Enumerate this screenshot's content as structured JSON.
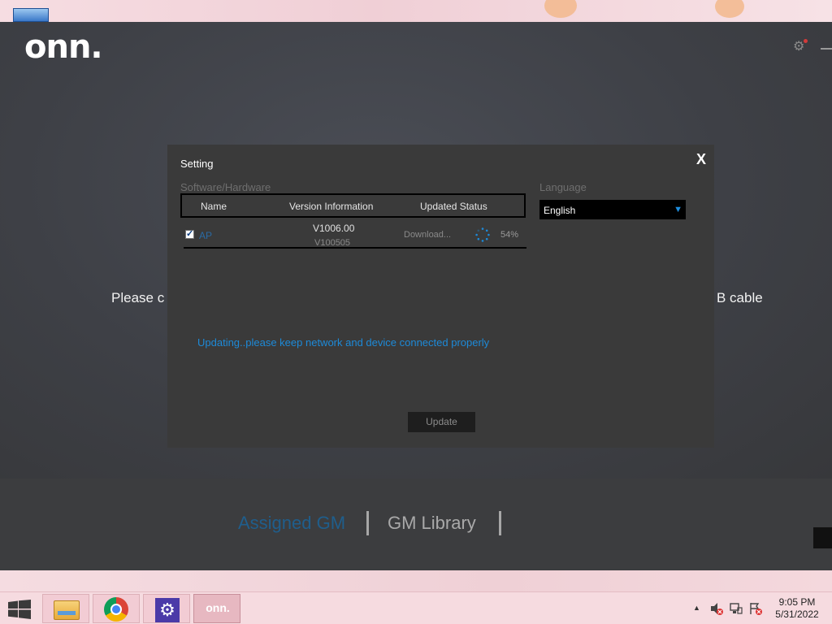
{
  "app": {
    "logo": "onn.",
    "background_prompt_left": "Please c",
    "background_prompt_right": "B cable"
  },
  "dialog": {
    "title": "Setting",
    "close_label": "X",
    "software_section_label": "Software/Hardware",
    "language_section_label": "Language",
    "table": {
      "headers": [
        "Name",
        "Version Information",
        "Updated Status"
      ],
      "rows": [
        {
          "checked": true,
          "name": "AP",
          "new_version": "V1006.00",
          "current_version": "V100505",
          "status": "Download...",
          "progress_text": "54%",
          "progress": 0.54
        }
      ]
    },
    "language": {
      "selected": "English"
    },
    "update_message": "Updating..please keep network and device connected properly",
    "update_button": "Update"
  },
  "tabs": {
    "assigned": "Assigned GM",
    "library": "GM Library"
  },
  "colors": {
    "accent": "#1d8ad8",
    "assigned_tab": "#1f5e8c",
    "modal_bg": "#3a3a3a",
    "taskbar_bg": "#f6dbe0"
  },
  "taskbar": {
    "apps": [
      {
        "name": "file-explorer",
        "icon": "folder-icon"
      },
      {
        "name": "chrome",
        "icon": "chrome-icon"
      },
      {
        "name": "settings",
        "icon": "gear-icon"
      },
      {
        "name": "onn",
        "label": "onn."
      }
    ],
    "clock": {
      "time": "9:05 PM",
      "date": "5/31/2022"
    }
  }
}
